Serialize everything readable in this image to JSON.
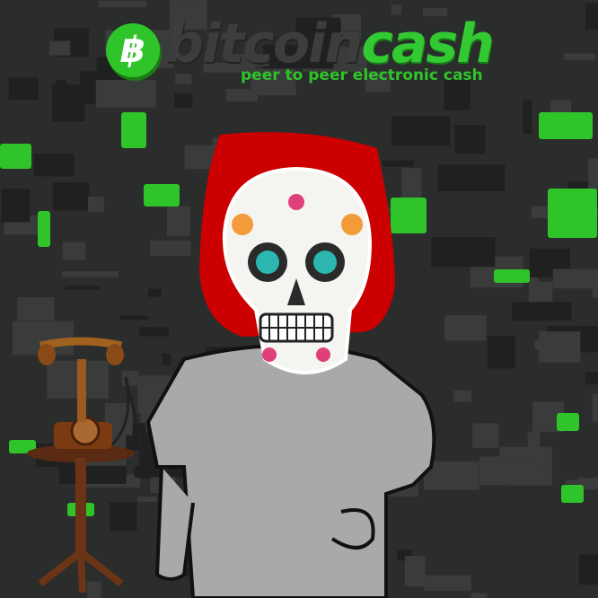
{
  "logo": {
    "icon": "bitcoin-b-icon",
    "coin_symbol": "฿",
    "word_part1": "bitcoin",
    "word_part2": "cash",
    "tagline": "peer to peer electronic cash",
    "colors": {
      "green": "#2fc42a",
      "dark": "#3d3d3d"
    }
  },
  "scene": {
    "background": "circuit-board-with-green-lights",
    "figure": "grey-wojak-with-sugar-skull-head-and-red-hair",
    "prop": "antique-telephone-on-wooden-table",
    "colors": {
      "hair": "#cc0000",
      "skin": "#a9a9a9",
      "board": "#2b2c2c"
    }
  }
}
